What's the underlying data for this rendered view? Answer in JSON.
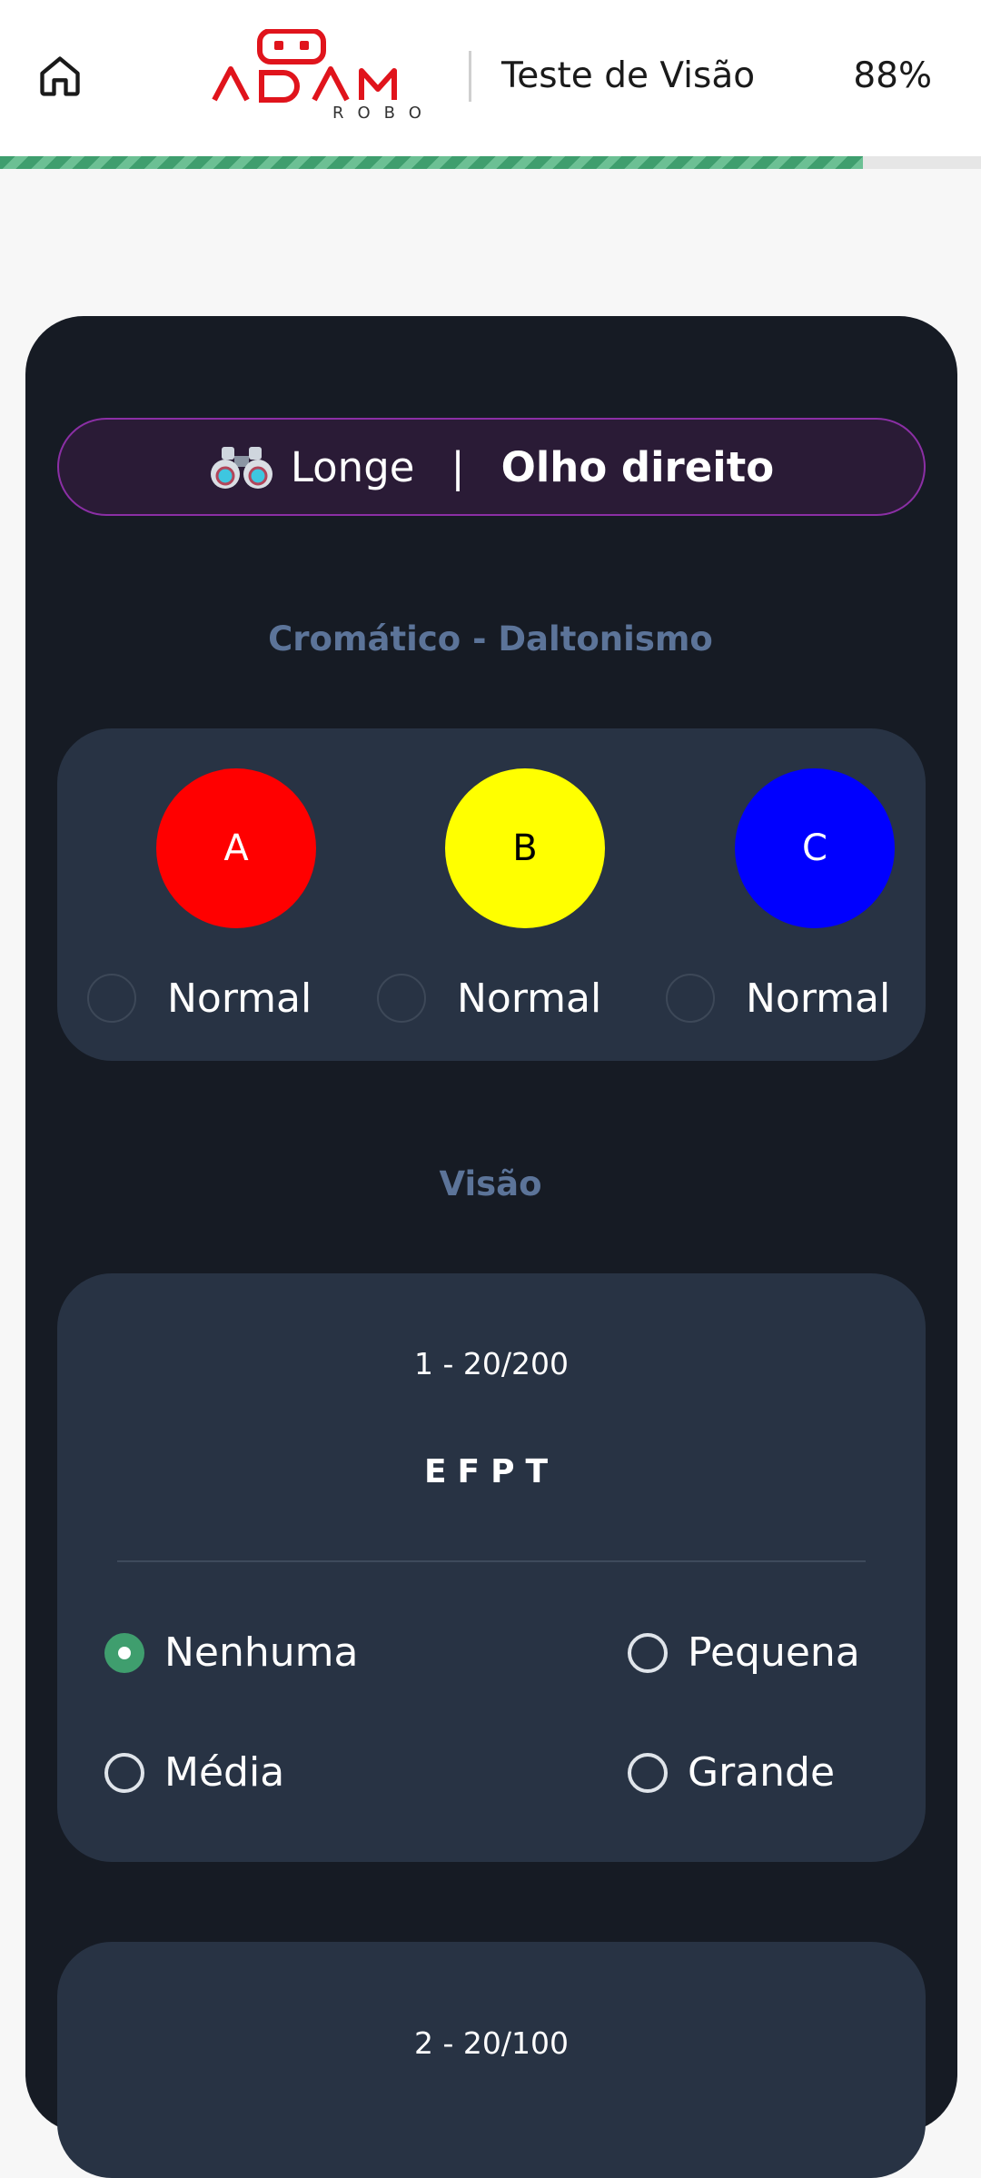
{
  "header": {
    "logo_text": "ADAM",
    "logo_subtext": "ROBO",
    "title": "Teste de Visão",
    "percent": "88%",
    "progress": 0.88
  },
  "eye_selector": {
    "distance": "Longe",
    "separator": "|",
    "eye": "Olho direito",
    "icon": "binoculars-icon"
  },
  "color_test": {
    "title": "Cromático - Daltonismo",
    "items": [
      {
        "letter": "A",
        "color": "#ff0000",
        "text_color": "#ffffff",
        "label": "Normal"
      },
      {
        "letter": "B",
        "color": "#ffff00",
        "text_color": "#000000",
        "label": "Normal"
      },
      {
        "letter": "C",
        "color": "#0000ff",
        "text_color": "#ffffff",
        "label": "Normal"
      }
    ]
  },
  "vision_test": {
    "title": "Visão",
    "rows": [
      {
        "title": "1 - 20/200",
        "letters": "EFPT",
        "options": [
          {
            "label": "Nenhuma",
            "selected": true
          },
          {
            "label": "Pequena",
            "selected": false
          },
          {
            "label": "Média",
            "selected": false
          },
          {
            "label": "Grande",
            "selected": false
          }
        ]
      },
      {
        "title": "2 - 20/100"
      }
    ]
  },
  "colors": {
    "accent_green": "#3f9e6e",
    "panel_bg": "#161b24",
    "card_bg": "#283344",
    "section_title": "#5c7499",
    "pill_border": "#8b2fa5"
  }
}
